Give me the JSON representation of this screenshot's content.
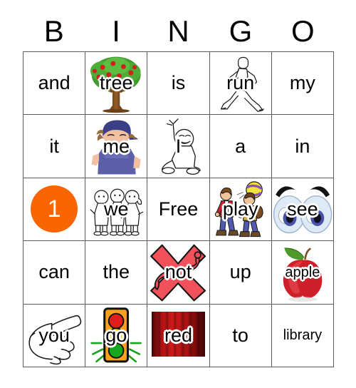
{
  "header": {
    "letters": [
      "B",
      "I",
      "N",
      "G",
      "O"
    ]
  },
  "colors": {
    "marker_orange": "#f96500",
    "grid_line": "#5a5a5a",
    "page_background": "#ffffff",
    "text": "#000000",
    "red_slat": "#b31313",
    "apple_red": "#d8202a",
    "traffic_light_body": "#f9a11b",
    "eye_iris": "#4a52a8"
  },
  "grid": {
    "rows": [
      [
        {
          "word": "and",
          "art": "none",
          "style": "plain"
        },
        {
          "word": "tree",
          "art": "apple-tree",
          "style": "outlined"
        },
        {
          "word": "is",
          "art": "none",
          "style": "plain"
        },
        {
          "word": "run",
          "art": "running-person",
          "style": "outlined"
        },
        {
          "word": "my",
          "art": "none",
          "style": "plain"
        }
      ],
      [
        {
          "word": "it",
          "art": "none",
          "style": "plain"
        },
        {
          "word": "me",
          "art": "boy-with-cap",
          "style": "outlined"
        },
        {
          "word": "I",
          "art": "sitting-child",
          "style": "outlined"
        },
        {
          "word": "a",
          "art": "none",
          "style": "plain"
        },
        {
          "word": "in",
          "art": "none",
          "style": "plain"
        }
      ],
      [
        {
          "word": "1",
          "art": "orange-marker-circle",
          "style": "marker"
        },
        {
          "word": "we",
          "art": "three-children",
          "style": "outlined"
        },
        {
          "word": "Free",
          "art": "none",
          "style": "plain"
        },
        {
          "word": "play",
          "art": "children-with-ball",
          "style": "outlined"
        },
        {
          "word": "see",
          "art": "pair-of-eyes",
          "style": "outlined"
        }
      ],
      [
        {
          "word": "can",
          "art": "none",
          "style": "plain"
        },
        {
          "word": "the",
          "art": "none",
          "style": "plain"
        },
        {
          "word": "not",
          "art": "red-x-character",
          "style": "outlined"
        },
        {
          "word": "up",
          "art": "none",
          "style": "plain"
        },
        {
          "word": "apple",
          "art": "red-apple",
          "style": "outlined-small"
        }
      ],
      [
        {
          "word": "you",
          "art": "pointing-hand",
          "style": "outlined"
        },
        {
          "word": "go",
          "art": "traffic-light",
          "style": "outlined"
        },
        {
          "word": "red",
          "art": "red-wood-panel",
          "style": "outlined"
        },
        {
          "word": "to",
          "art": "none",
          "style": "plain"
        },
        {
          "word": "library",
          "art": "none",
          "style": "plain-small"
        }
      ]
    ]
  }
}
